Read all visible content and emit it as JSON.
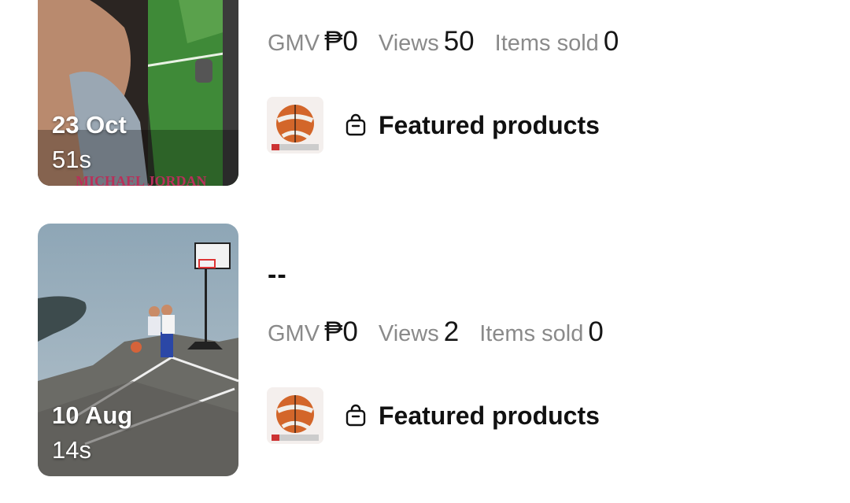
{
  "videos": [
    {
      "date": "23 Oct",
      "duration": "51s",
      "title": "",
      "metrics": [
        {
          "label": "GMV",
          "value": "₱0"
        },
        {
          "label": "Views",
          "value": "50"
        },
        {
          "label": "Items sold",
          "value": "0"
        }
      ],
      "featured_label": "Featured products",
      "thumb_icon": "video-thumbnail"
    },
    {
      "date": "10 Aug",
      "duration": "14s",
      "title": "--",
      "metrics": [
        {
          "label": "GMV",
          "value": "₱0"
        },
        {
          "label": "Views",
          "value": "2"
        },
        {
          "label": "Items sold",
          "value": "0"
        }
      ],
      "featured_label": "Featured products",
      "thumb_icon": "video-thumbnail"
    }
  ],
  "icons": {
    "featured": "shopping-bag-icon",
    "product": "basketball-product-image"
  },
  "colors": {
    "metric_label": "#8a8a8a",
    "metric_value": "#161616",
    "text": "#111111"
  }
}
